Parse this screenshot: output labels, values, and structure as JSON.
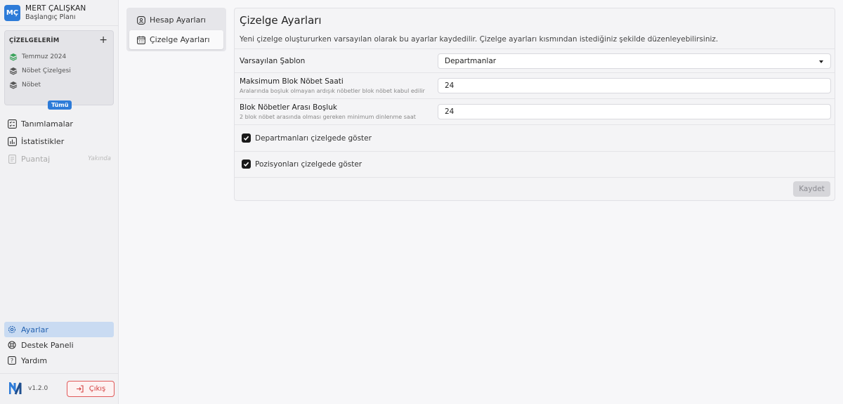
{
  "user": {
    "initials": "MÇ",
    "name": "MERT ÇALIŞKAN",
    "plan": "Başlangıç Planı"
  },
  "schedules": {
    "heading": "ÇİZELGELERİM",
    "add_icon": "plus-icon",
    "items": [
      {
        "label": "Temmuz 2024",
        "icon": "layers-icon",
        "color": "#3aa35b"
      },
      {
        "label": "Nöbet Çizelgesi",
        "icon": "layers-icon",
        "color": "#555555"
      },
      {
        "label": "Nöbet",
        "icon": "layers-icon",
        "color": "#555555"
      }
    ],
    "all_label": "Tümü"
  },
  "nav": {
    "definitions": "Tanımlamalar",
    "statistics": "İstatistikler",
    "timesheet": "Puantaj",
    "timesheet_badge": "Yakında",
    "settings": "Ayarlar",
    "support": "Destek Paneli",
    "help": "Yardım"
  },
  "footer": {
    "version": "v1.2.0",
    "logout": "Çıkış"
  },
  "settings_tabs": [
    {
      "label": "Hesap Ayarları",
      "icon": "user-shield-icon"
    },
    {
      "label": "Çizelge Ayarları",
      "icon": "calendar-icon",
      "active": true
    }
  ],
  "main": {
    "title": "Çizelge Ayarları",
    "description": "Yeni çizelge oluştururken varsayılan olarak bu ayarlar kaydedilir. Çizelge ayarları kısmından istediğiniz şekilde düzenleyebilirsiniz.",
    "default_template": {
      "label": "Varsayılan Şablon",
      "value": "Departmanlar"
    },
    "max_block": {
      "label": "Maksimum Blok Nöbet Saati",
      "sub": "Aralarında boşluk olmayan ardışık nöbetler blok nöbet kabul edilir",
      "value": "24"
    },
    "block_gap": {
      "label": "Blok Nöbetler Arası Boşluk",
      "sub": "2 blok nöbet arasında olması gereken minimum dinlenme saat",
      "value": "24"
    },
    "show_departments": "Departmanları çizelgede göster",
    "show_positions": "Pozisyonları çizelgede göster",
    "save": "Kaydet"
  },
  "colors": {
    "accent": "#2d7bd8",
    "danger": "#d43f3f"
  }
}
